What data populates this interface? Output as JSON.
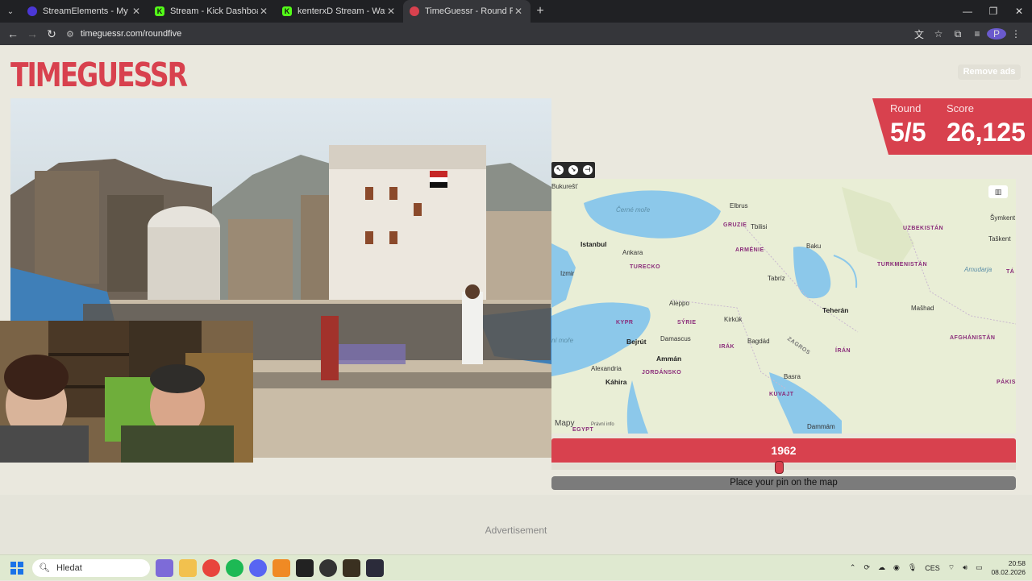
{
  "browser": {
    "tabs": [
      {
        "title": "StreamElements - My dashboar",
        "favicon_color": "#4b37d6",
        "icon": "streamelements-icon"
      },
      {
        "title": "Stream - Kick Dashboard",
        "favicon_color": "#53fc18",
        "icon": "kick-icon"
      },
      {
        "title": "kenterxD Stream - Watch Live o",
        "favicon_color": "#53fc18",
        "icon": "kick-icon"
      },
      {
        "title": "TimeGuessr - Round Five",
        "favicon_color": "#d8414e",
        "icon": "timeguessr-icon",
        "active": true
      }
    ],
    "url": "timeguessr.com/roundfive"
  },
  "page": {
    "logo": "TIMEGUESSR",
    "remove_ads": "Remove ads",
    "round_label": "Round",
    "round_value": "5/5",
    "score_label": "Score",
    "score_value": "26,125",
    "year": "1962",
    "year_slider_fraction": 0.49,
    "pin_prompt": "Place your pin on the map",
    "advertisement": "Advertisement",
    "accent_color": "#d8414e"
  },
  "map": {
    "attribution_brand": "Mapy",
    "attribution_legal": "Právní info",
    "labels": {
      "bucuresti": "Bukurešť",
      "cerne_more": "Černé moře",
      "elbrus": "Elbrus",
      "gruzie": "GRUZIE",
      "tbilisi": "Tbilisi",
      "istanbul": "Istanbul",
      "ankara": "Ankara",
      "armenie": "ARMÉNIE",
      "baku": "Baku",
      "uzbekistan": "UZBEKISTÁN",
      "symkent": "Šymkent",
      "taskent": "Taškent",
      "turecko": "TURECKO",
      "izmir": "Izmir",
      "tabriz": "Tabríz",
      "turkmenistan": "TURKMENISTÁN",
      "amudarja": "Amudarja",
      "aleppo": "Aleppo",
      "teheran": "Teherán",
      "mashad": "Mašhad",
      "kypr": "KYPR",
      "kirkuk": "Kirkúk",
      "syrie": "SÝRIE",
      "bejrut": "Bejrút",
      "damascus": "Damascus",
      "bagdad": "Bagdád",
      "irak": "IRÁK",
      "zagros": "ZAGROS",
      "iran": "ÍRÁN",
      "afghanistan": "AFGHÁNISTÁN",
      "ni_more": "ní moře",
      "amman": "Ammán",
      "jordansko": "JORDÁNSKO",
      "alexandria": "Alexandria",
      "basra": "Basra",
      "kahira": "Káhira",
      "kuvajt": "KUVAJT",
      "pakis": "PÁKIS",
      "dammam": "Dammám",
      "egypt": "EGYPT",
      "ta": "TÁ"
    }
  },
  "taskbar": {
    "search_placeholder": "Hledat",
    "language": "CES",
    "time": "20:58",
    "date": "08.02.2026"
  }
}
